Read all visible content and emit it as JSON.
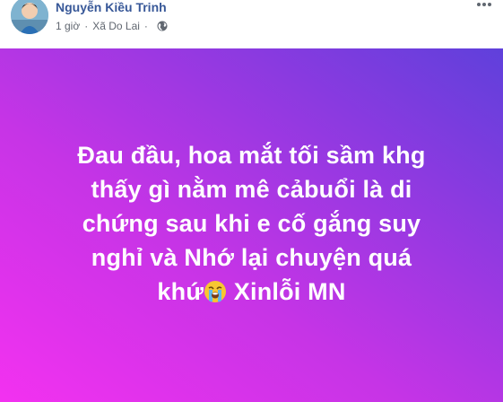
{
  "post": {
    "author": "Nguyễn Kiều Trinh",
    "time": "1 giờ",
    "separator": "·",
    "location": "Xã Do Lai",
    "privacy_icon": "globe-icon",
    "options_icon": "more-options-icon",
    "text_lines": [
      "Đau đầu, hoa mắt tối sầm khg",
      "thấy gì nằm mê cảbuổi là di",
      "chứng sau khi e cố gắng suy",
      "nghỉ và Nhớ lại chuyện quá"
    ],
    "last_line_before_emoji": "khứ",
    "emoji_icon": "loudly-crying-face-icon",
    "last_line_after_emoji": " Xinlỗi MN",
    "background_colors": [
      "#f331f0",
      "#c634e6",
      "#8a3ae0",
      "#5f40db"
    ],
    "author_color": "#385898"
  }
}
